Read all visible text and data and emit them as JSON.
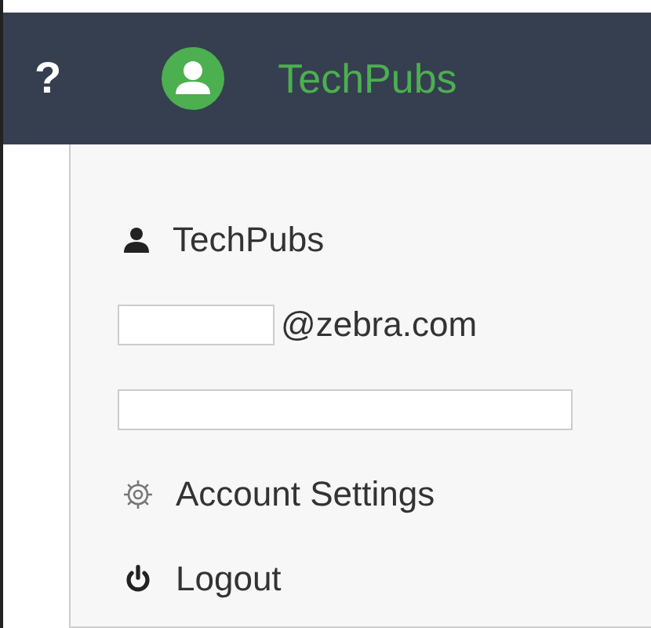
{
  "header": {
    "help": "?",
    "user_name": "TechPubs"
  },
  "menu": [
    {
      "kind": "user",
      "label": "TechPubs"
    },
    {
      "kind": "email",
      "label": "@zebra.com"
    },
    {
      "kind": "field"
    },
    {
      "kind": "settings",
      "label": "Account Settings"
    },
    {
      "kind": "logout",
      "label": "Logout"
    }
  ]
}
